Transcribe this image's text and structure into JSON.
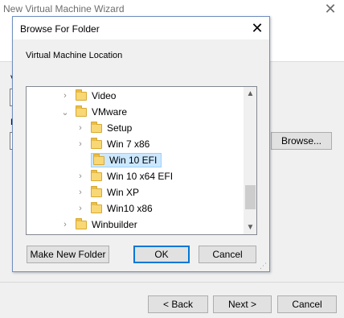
{
  "wizard": {
    "title": "New Virtual Machine Wizard",
    "close_glyph": "✕",
    "stub_letters": [
      "V",
      "L"
    ],
    "browse_label": "Browse...",
    "back_label": "< Back",
    "next_label": "Next >",
    "cancel_label": "Cancel"
  },
  "dialog": {
    "title": "Browse For Folder",
    "close_glyph": "✕",
    "label": "Virtual Machine Location",
    "tree": [
      {
        "label": "Video",
        "expander": "›",
        "level": 0,
        "selected": false
      },
      {
        "label": "VMware",
        "expander": "⌄",
        "level": 0,
        "selected": false
      },
      {
        "label": "Setup",
        "expander": "›",
        "level": 1,
        "selected": false
      },
      {
        "label": "Win 7 x86",
        "expander": "›",
        "level": 1,
        "selected": false
      },
      {
        "label": "Win 10 EFI",
        "expander": "",
        "level": 1,
        "selected": true
      },
      {
        "label": "Win 10 x64 EFI",
        "expander": "›",
        "level": 1,
        "selected": false
      },
      {
        "label": "Win XP",
        "expander": "›",
        "level": 1,
        "selected": false
      },
      {
        "label": "Win10 x86",
        "expander": "›",
        "level": 1,
        "selected": false
      },
      {
        "label": "Winbuilder",
        "expander": "›",
        "level": 0,
        "selected": false
      }
    ],
    "scroll_up": "▲",
    "scroll_down": "▼",
    "make_new_folder_label": "Make New Folder",
    "ok_label": "OK",
    "cancel_label": "Cancel",
    "resize_glyph": "⋰"
  }
}
